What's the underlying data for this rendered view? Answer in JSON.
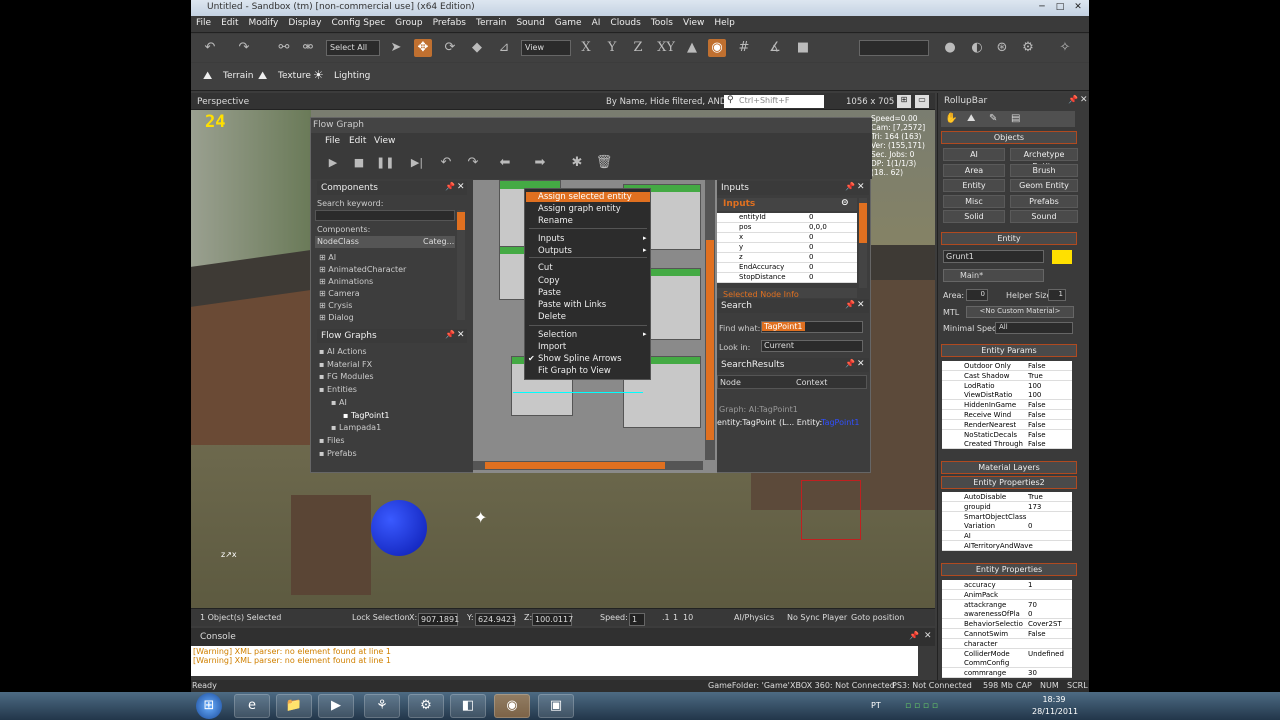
{
  "window": {
    "title": "Untitled - Sandbox (tm) [non-commercial use] (x64 Edition)"
  },
  "menu": [
    "File",
    "Edit",
    "Modify",
    "Display",
    "Config Spec",
    "Group",
    "Prefabs",
    "Terrain",
    "Sound",
    "Game",
    "AI",
    "Clouds",
    "Tools",
    "View",
    "Help"
  ],
  "toolbar": {
    "select_combo": "Select All",
    "view_combo": "View",
    "axis_x": "X",
    "axis_y": "Y",
    "axis_z": "Z",
    "axis_xy": "XY"
  },
  "toolbar2": {
    "terrain": "Terrain",
    "texture": "Texture",
    "lighting": "Lighting"
  },
  "viewport": {
    "label": "Perspective",
    "filter_text": "By Name, Hide filtered, AND",
    "search_placeholder": "Ctrl+Shift+F",
    "resolution": "1056 x 705",
    "fps": "24",
    "overlay_lines": [
      "Speed=0.00",
      "Cam: [7,2572]",
      "Tri: 164 (163)",
      "Ver: (155,171)",
      "Sec. Jobs: 0",
      "DP: 1(1/1/3)",
      "(18.. 62)"
    ]
  },
  "status": {
    "selected": "1 Object(s) Selected",
    "lock": "Lock Selection",
    "x_label": "X:",
    "x": "907.1891",
    "y_label": "Y:",
    "y": "624.9423",
    "z_label": "Z:",
    "z": "100.0117",
    "speed_label": "Speed:",
    "speed": "1",
    "s1": ".1",
    "s2": "1",
    "s3": "10",
    "ai": "AI/Physics",
    "sync": "No Sync Player",
    "goto": "Goto position"
  },
  "console": {
    "title": "Console",
    "lines": [
      "[Warning] XML parser: no element found at line 1",
      "[Warning] XML parser: no element found at line 1"
    ]
  },
  "statusline": {
    "ready": "Ready",
    "gamefolder": "GameFolder: 'Game'",
    "xbox": "XBOX 360: Not Connected",
    "ps3": "PS3: Not Connected",
    "mem": "598 Mb",
    "cap": "CAP",
    "num": "NUM",
    "scrl": "SCRL"
  },
  "flowgraph": {
    "title": "Flow Graph",
    "menu": [
      "File",
      "Edit",
      "View"
    ],
    "components": {
      "title": "Components",
      "search_label": "Search keyword:",
      "list_label": "Components:",
      "col1": "NodeClass",
      "col2": "Categ...",
      "items": [
        "AI",
        "AnimatedCharacter",
        "Animations",
        "Camera",
        "Crysis",
        "Dialog"
      ]
    },
    "graphs": {
      "title": "Flow Graphs",
      "items": [
        "AI Actions",
        "Material FX",
        "FG Modules",
        "Entities",
        "AI",
        "TagPoint1",
        "Lampada1",
        "Files",
        "Prefabs"
      ]
    },
    "inputs": {
      "title": "Inputs",
      "header": "Inputs",
      "rows": [
        [
          "entityId",
          "0"
        ],
        [
          "pos",
          "0,0,0"
        ],
        [
          "x",
          "0"
        ],
        [
          "y",
          "0"
        ],
        [
          "z",
          "0"
        ],
        [
          "EndAccuracy",
          "0"
        ],
        [
          "StopDistance",
          "0"
        ]
      ],
      "footer": "Selected Node Info"
    },
    "search": {
      "title": "Search",
      "find_label": "Find what:",
      "find_value": "TagPoint1",
      "lookin_label": "Look in:",
      "lookin_value": "Current"
    },
    "results": {
      "title": "SearchResults",
      "col1": "Node",
      "col2": "Context",
      "group": "Graph: AI:TagPoint1",
      "row_node": "entity:TagPoint",
      "row_ctx": "(L... Entity:",
      "row_val": "TagPoint1"
    }
  },
  "context_menu": [
    "Assign selected entity",
    "Assign graph entity",
    "Rename",
    "Inputs",
    "Outputs",
    "Cut",
    "Copy",
    "Paste",
    "Paste with Links",
    "Delete",
    "Selection",
    "Import",
    "Show Spline Arrows",
    "Fit Graph to View"
  ],
  "rollup": {
    "title": "RollupBar",
    "objects_title": "Objects",
    "object_buttons": [
      "AI",
      "Archetype Entity",
      "Area",
      "Brush",
      "Entity",
      "Geom Entity",
      "Misc",
      "Prefabs",
      "Solid",
      "Sound"
    ],
    "entity_title": "Entity",
    "entity_name": "Grunt1",
    "layer": "Main*",
    "area_label": "Area:",
    "area_value": "0",
    "helper_label": "Helper Size:",
    "helper_value": "1",
    "mtl_label": "MTL",
    "mtl_value": "<No Custom Material>",
    "minspec_label": "Minimal Spec:",
    "minspec_value": "All",
    "params_title": "Entity Params",
    "params": [
      [
        "Outdoor Only",
        "False"
      ],
      [
        "Cast Shadow",
        "True"
      ],
      [
        "LodRatio",
        "100"
      ],
      [
        "ViewDistRatio",
        "100"
      ],
      [
        "HiddenInGame",
        "False"
      ],
      [
        "Receive Wind",
        "False"
      ],
      [
        "RenderNearest",
        "False"
      ],
      [
        "NoStaticDecals",
        "False"
      ],
      [
        "Created Through",
        "False"
      ]
    ],
    "layers_title": "Material Layers",
    "props2_title": "Entity Properties2",
    "props2": [
      [
        "AutoDisable",
        "True"
      ],
      [
        "groupid",
        "173"
      ],
      [
        "SmartObjectClass",
        ""
      ],
      [
        "Variation",
        "0"
      ],
      [
        "AI",
        ""
      ],
      [
        "AITerritoryAndWave",
        ""
      ]
    ],
    "props_title": "Entity Properties",
    "props": [
      [
        "accuracy",
        "1"
      ],
      [
        "AnimPack",
        ""
      ],
      [
        "attackrange",
        "70"
      ],
      [
        "awarenessOfPla",
        "0"
      ],
      [
        "BehaviorSelectio",
        "Cover2ST"
      ],
      [
        "CannotSwim",
        "False"
      ],
      [
        "character",
        ""
      ],
      [
        "ColliderMode",
        "Undefined"
      ],
      [
        "CommConfig",
        ""
      ],
      [
        "commrange",
        "30"
      ]
    ]
  },
  "taskbar": {
    "lang": "PT",
    "time": "18:39",
    "date": "28/11/2011"
  },
  "colors": {
    "accent": "#c07030",
    "warning": "#d08000",
    "highlight": "#ffe000"
  }
}
